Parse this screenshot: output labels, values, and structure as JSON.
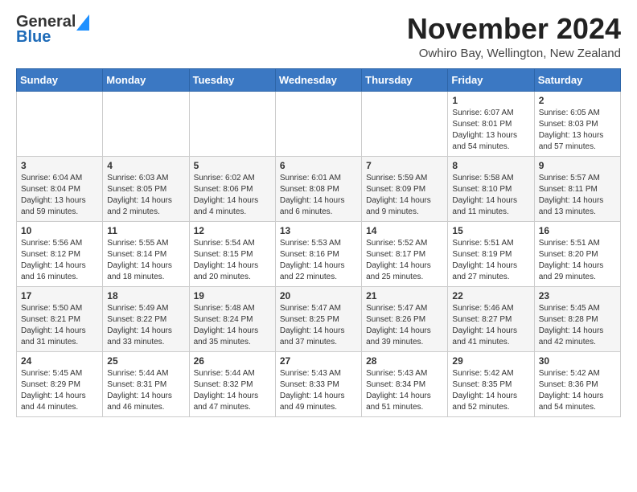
{
  "header": {
    "logo_general": "General",
    "logo_blue": "Blue",
    "title": "November 2024",
    "subtitle": "Owhiro Bay, Wellington, New Zealand"
  },
  "columns": [
    "Sunday",
    "Monday",
    "Tuesday",
    "Wednesday",
    "Thursday",
    "Friday",
    "Saturday"
  ],
  "weeks": [
    [
      {
        "day": "",
        "info": ""
      },
      {
        "day": "",
        "info": ""
      },
      {
        "day": "",
        "info": ""
      },
      {
        "day": "",
        "info": ""
      },
      {
        "day": "",
        "info": ""
      },
      {
        "day": "1",
        "info": "Sunrise: 6:07 AM\nSunset: 8:01 PM\nDaylight: 13 hours\nand 54 minutes."
      },
      {
        "day": "2",
        "info": "Sunrise: 6:05 AM\nSunset: 8:03 PM\nDaylight: 13 hours\nand 57 minutes."
      }
    ],
    [
      {
        "day": "3",
        "info": "Sunrise: 6:04 AM\nSunset: 8:04 PM\nDaylight: 13 hours\nand 59 minutes."
      },
      {
        "day": "4",
        "info": "Sunrise: 6:03 AM\nSunset: 8:05 PM\nDaylight: 14 hours\nand 2 minutes."
      },
      {
        "day": "5",
        "info": "Sunrise: 6:02 AM\nSunset: 8:06 PM\nDaylight: 14 hours\nand 4 minutes."
      },
      {
        "day": "6",
        "info": "Sunrise: 6:01 AM\nSunset: 8:08 PM\nDaylight: 14 hours\nand 6 minutes."
      },
      {
        "day": "7",
        "info": "Sunrise: 5:59 AM\nSunset: 8:09 PM\nDaylight: 14 hours\nand 9 minutes."
      },
      {
        "day": "8",
        "info": "Sunrise: 5:58 AM\nSunset: 8:10 PM\nDaylight: 14 hours\nand 11 minutes."
      },
      {
        "day": "9",
        "info": "Sunrise: 5:57 AM\nSunset: 8:11 PM\nDaylight: 14 hours\nand 13 minutes."
      }
    ],
    [
      {
        "day": "10",
        "info": "Sunrise: 5:56 AM\nSunset: 8:12 PM\nDaylight: 14 hours\nand 16 minutes."
      },
      {
        "day": "11",
        "info": "Sunrise: 5:55 AM\nSunset: 8:14 PM\nDaylight: 14 hours\nand 18 minutes."
      },
      {
        "day": "12",
        "info": "Sunrise: 5:54 AM\nSunset: 8:15 PM\nDaylight: 14 hours\nand 20 minutes."
      },
      {
        "day": "13",
        "info": "Sunrise: 5:53 AM\nSunset: 8:16 PM\nDaylight: 14 hours\nand 22 minutes."
      },
      {
        "day": "14",
        "info": "Sunrise: 5:52 AM\nSunset: 8:17 PM\nDaylight: 14 hours\nand 25 minutes."
      },
      {
        "day": "15",
        "info": "Sunrise: 5:51 AM\nSunset: 8:19 PM\nDaylight: 14 hours\nand 27 minutes."
      },
      {
        "day": "16",
        "info": "Sunrise: 5:51 AM\nSunset: 8:20 PM\nDaylight: 14 hours\nand 29 minutes."
      }
    ],
    [
      {
        "day": "17",
        "info": "Sunrise: 5:50 AM\nSunset: 8:21 PM\nDaylight: 14 hours\nand 31 minutes."
      },
      {
        "day": "18",
        "info": "Sunrise: 5:49 AM\nSunset: 8:22 PM\nDaylight: 14 hours\nand 33 minutes."
      },
      {
        "day": "19",
        "info": "Sunrise: 5:48 AM\nSunset: 8:24 PM\nDaylight: 14 hours\nand 35 minutes."
      },
      {
        "day": "20",
        "info": "Sunrise: 5:47 AM\nSunset: 8:25 PM\nDaylight: 14 hours\nand 37 minutes."
      },
      {
        "day": "21",
        "info": "Sunrise: 5:47 AM\nSunset: 8:26 PM\nDaylight: 14 hours\nand 39 minutes."
      },
      {
        "day": "22",
        "info": "Sunrise: 5:46 AM\nSunset: 8:27 PM\nDaylight: 14 hours\nand 41 minutes."
      },
      {
        "day": "23",
        "info": "Sunrise: 5:45 AM\nSunset: 8:28 PM\nDaylight: 14 hours\nand 42 minutes."
      }
    ],
    [
      {
        "day": "24",
        "info": "Sunrise: 5:45 AM\nSunset: 8:29 PM\nDaylight: 14 hours\nand 44 minutes."
      },
      {
        "day": "25",
        "info": "Sunrise: 5:44 AM\nSunset: 8:31 PM\nDaylight: 14 hours\nand 46 minutes."
      },
      {
        "day": "26",
        "info": "Sunrise: 5:44 AM\nSunset: 8:32 PM\nDaylight: 14 hours\nand 47 minutes."
      },
      {
        "day": "27",
        "info": "Sunrise: 5:43 AM\nSunset: 8:33 PM\nDaylight: 14 hours\nand 49 minutes."
      },
      {
        "day": "28",
        "info": "Sunrise: 5:43 AM\nSunset: 8:34 PM\nDaylight: 14 hours\nand 51 minutes."
      },
      {
        "day": "29",
        "info": "Sunrise: 5:42 AM\nSunset: 8:35 PM\nDaylight: 14 hours\nand 52 minutes."
      },
      {
        "day": "30",
        "info": "Sunrise: 5:42 AM\nSunset: 8:36 PM\nDaylight: 14 hours\nand 54 minutes."
      }
    ]
  ]
}
